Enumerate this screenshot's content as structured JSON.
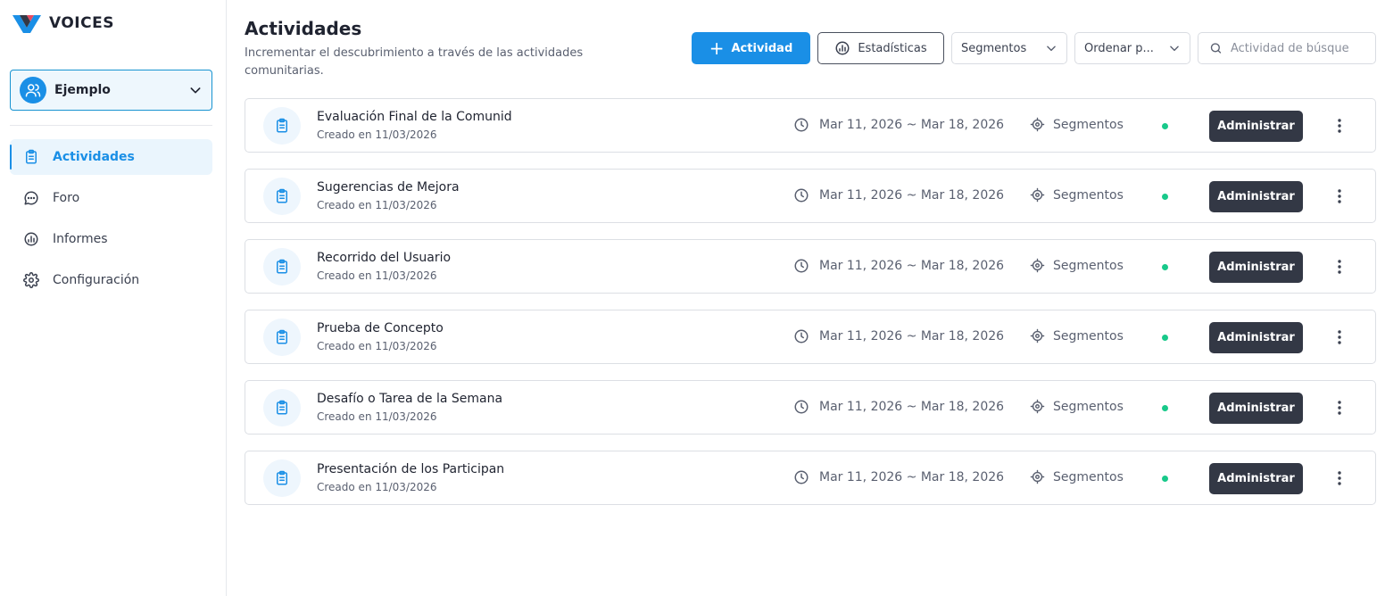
{
  "brand": {
    "name": "VOICES"
  },
  "workspace": {
    "label": "Ejemplo"
  },
  "nav": [
    {
      "label": "Actividades"
    },
    {
      "label": "Foro"
    },
    {
      "label": "Informes"
    },
    {
      "label": "Configuración"
    }
  ],
  "header": {
    "title": "Actividades",
    "subtitle": "Incrementar el descubrimiento a través de las actividades comunitarias."
  },
  "toolbar": {
    "add_label": "Actividad",
    "stats_label": "Estadísticas",
    "segments_label": "Segmentos",
    "sort_label": "Ordenar p...",
    "search_placeholder": "Actividad de búsque"
  },
  "colors": {
    "accent": "#1a8fe6",
    "dark_button": "#333845",
    "status_active": "#18c98a"
  },
  "activities": [
    {
      "title": "Evaluación Final de la Comunid",
      "created": "Creado en 11/03/2026",
      "dates": "Mar 11, 2026 ~ Mar 18, 2026",
      "segment": "Segmentos",
      "action": "Administrar"
    },
    {
      "title": "Sugerencias de Mejora",
      "created": "Creado en 11/03/2026",
      "dates": "Mar 11, 2026 ~ Mar 18, 2026",
      "segment": "Segmentos",
      "action": "Administrar"
    },
    {
      "title": "Recorrido del Usuario",
      "created": "Creado en 11/03/2026",
      "dates": "Mar 11, 2026 ~ Mar 18, 2026",
      "segment": "Segmentos",
      "action": "Administrar"
    },
    {
      "title": "Prueba de Concepto",
      "created": "Creado en 11/03/2026",
      "dates": "Mar 11, 2026 ~ Mar 18, 2026",
      "segment": "Segmentos",
      "action": "Administrar"
    },
    {
      "title": "Desafío o Tarea de la Semana",
      "created": "Creado en 11/03/2026",
      "dates": "Mar 11, 2026 ~ Mar 18, 2026",
      "segment": "Segmentos",
      "action": "Administrar"
    },
    {
      "title": "Presentación de los Participan",
      "created": "Creado en 11/03/2026",
      "dates": "Mar 11, 2026 ~ Mar 18, 2026",
      "segment": "Segmentos",
      "action": "Administrar"
    }
  ]
}
